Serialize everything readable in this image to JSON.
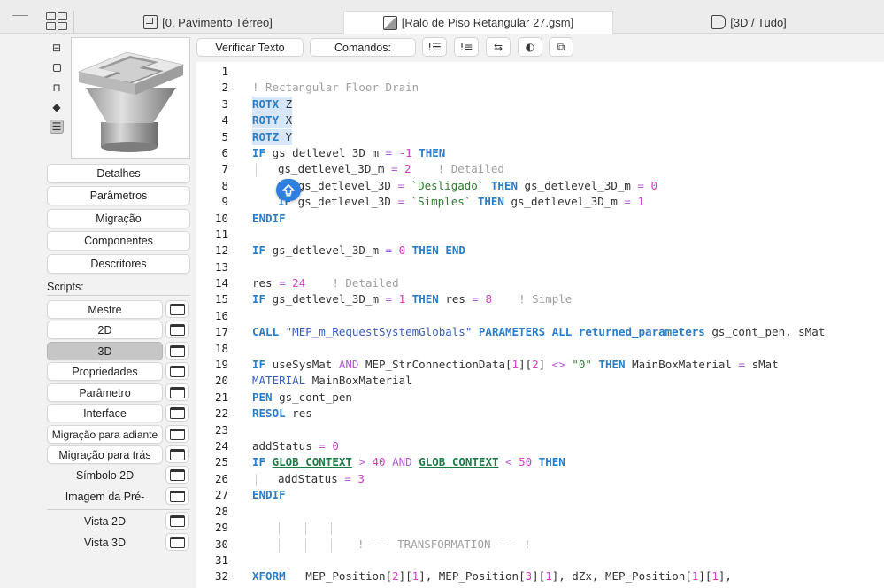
{
  "tabs": [
    {
      "label": "[0. Pavimento Térreo]",
      "icon": "floor-plan-icon"
    },
    {
      "label": "[Ralo de Piso Retangular 27.gsm]",
      "icon": "gsm-object-icon"
    },
    {
      "label": "[3D / Tudo]",
      "icon": "3d-view-icon"
    }
  ],
  "sidebar": {
    "sections": [
      "Detalhes",
      "Parâmetros",
      "Migração",
      "Componentes",
      "Descritores"
    ],
    "scripts_label": "Scripts:",
    "scripts": [
      "Mestre",
      "2D",
      "3D",
      "Propriedades",
      "Parâmetro",
      "Interface",
      "Migração para adiante",
      "Migração para trás",
      "Símbolo 2D",
      "Imagem da Pré-"
    ],
    "views": [
      "Vista 2D",
      "Vista 3D"
    ],
    "selected_script": "3D"
  },
  "toolbar": {
    "check_script": "Verificar Texto",
    "commands": "Comandos:"
  },
  "line_numbers": [
    "1",
    "2",
    "3",
    "4",
    "5",
    "6",
    "7",
    "8",
    "9",
    "10",
    "11",
    "12",
    "13",
    "14",
    "15",
    "16",
    "17",
    "18",
    "19",
    "20",
    "21",
    "22",
    "23",
    "24",
    "25",
    "26",
    "27",
    "28",
    "29",
    "30",
    "31",
    "32"
  ],
  "code": {
    "l2": "! Rectangular Floor Drain",
    "l3": [
      "ROTX",
      "Z"
    ],
    "l4": [
      "ROTY",
      "X"
    ],
    "l5": [
      "ROTZ",
      "Y"
    ],
    "l6": [
      "IF",
      "gs_detlevel_3D_m",
      "=",
      "-1",
      "THEN"
    ],
    "l7": [
      "gs_detlevel_3D_m",
      "=",
      "2",
      "! Detailed"
    ],
    "l8": [
      "IF",
      "gs_detlevel_3D",
      "=",
      "`Desligado`",
      "THEN",
      "gs_detlevel_3D_m",
      "=",
      "0"
    ],
    "l9": [
      "IF",
      "gs_detlevel_3D",
      "=",
      "`Simples`",
      "THEN",
      "gs_detlevel_3D_m",
      "=",
      "1"
    ],
    "l10": "ENDIF",
    "l12": [
      "IF",
      "gs_detlevel_3D_m",
      "=",
      "0",
      "THEN",
      "END"
    ],
    "l14": [
      "res",
      "=",
      "24",
      "! Detailed"
    ],
    "l15": [
      "IF",
      "gs_detlevel_3D_m",
      "=",
      "1",
      "THEN",
      "res",
      "=",
      "8",
      "! Simple"
    ],
    "l17": [
      "CALL",
      "\"MEP_m_RequestSystemGlobals\"",
      "PARAMETERS",
      "ALL",
      "returned_parameters",
      "gs_cont_pen, sMat"
    ],
    "l19": [
      "IF",
      "useSysMat",
      "AND",
      "MEP_StrConnectionData[",
      "1",
      "][",
      "2",
      "]",
      "<>",
      "\"0\"",
      "THEN",
      "MainBoxMaterial",
      "=",
      "sMat"
    ],
    "l20": [
      "MATERIAL",
      "MainBoxMaterial"
    ],
    "l21": [
      "PEN",
      "gs_cont_pen"
    ],
    "l22": [
      "RESOL",
      "res"
    ],
    "l24": [
      "addStatus",
      "=",
      "0"
    ],
    "l25": [
      "IF",
      "GLOB_CONTEXT",
      ">",
      "40",
      "AND",
      "GLOB_CONTEXT",
      "<",
      "50",
      "THEN"
    ],
    "l26": [
      "addStatus",
      "=",
      "3"
    ],
    "l27": "ENDIF",
    "l30": "! --- TRANSFORMATION --- !",
    "l32": [
      "XFORM",
      "MEP_Position[",
      "2",
      "][",
      "1",
      "], MEP_Position[",
      "3",
      "][",
      "1",
      "], dZx, MEP_Position[",
      "1",
      "][",
      "1",
      "],"
    ]
  },
  "colors": {
    "keyword": "#2a7ec9",
    "number": "#d83bcd",
    "comment": "#a0a0a0",
    "string": "#2f7c2f",
    "selection": "#d7e6f8",
    "fab": "#2f7fe0"
  }
}
